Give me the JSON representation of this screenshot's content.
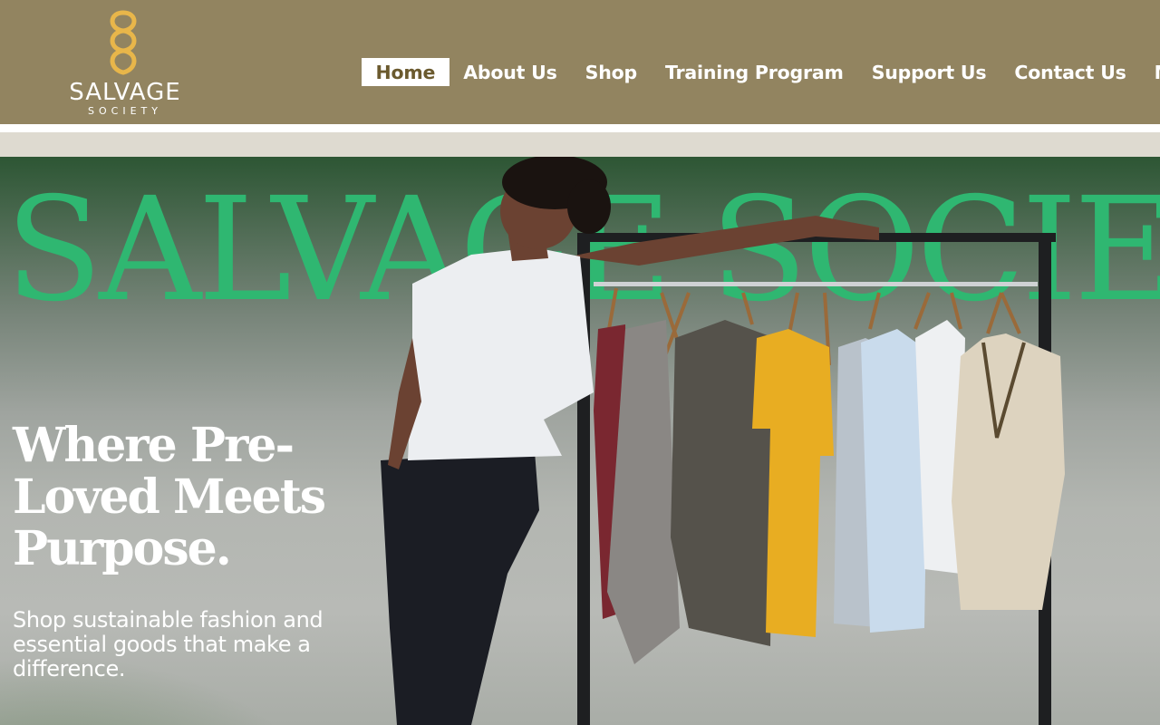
{
  "brand": {
    "name": "SALVAGE",
    "tagline": "SOCIETY",
    "logo_icon": "infinity-knot-icon",
    "colors": {
      "header_bg": "#928460",
      "logo_gold": "#e8b64a",
      "accent_green": "#2fb771",
      "strip": "#dedad0"
    }
  },
  "nav": {
    "items": [
      {
        "label": "Home",
        "active": true
      },
      {
        "label": "About Us"
      },
      {
        "label": "Shop"
      },
      {
        "label": "Training Program"
      },
      {
        "label": "Support Us"
      },
      {
        "label": "Contact Us"
      },
      {
        "label": "More"
      }
    ]
  },
  "hero": {
    "background_title": "SALVAGE SOCIETY",
    "headline_lines": [
      "Where Pre-",
      "Loved Meets",
      "Purpose."
    ],
    "subtext_lines": [
      "Shop sustainable fashion and",
      "essential goods that make a",
      "difference."
    ]
  }
}
